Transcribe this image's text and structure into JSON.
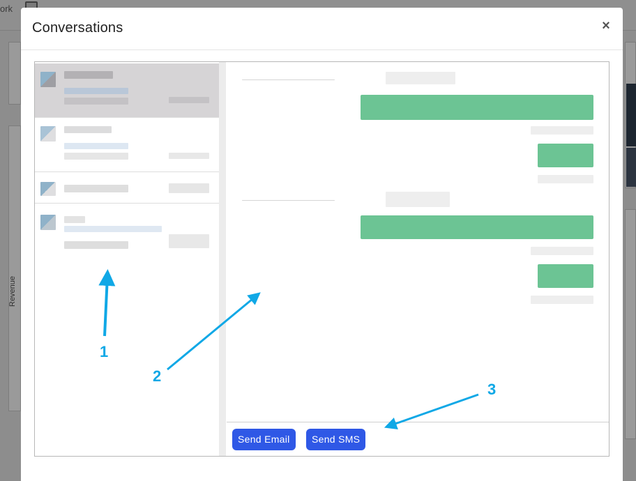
{
  "background": {
    "partial_label": "ork",
    "side_label": "Revenue"
  },
  "modal": {
    "title": "Conversations",
    "close_icon": "close-icon"
  },
  "conversations": [
    {
      "state": "selected"
    },
    {
      "state": "default"
    },
    {
      "state": "default"
    },
    {
      "state": "default"
    }
  ],
  "composer": {
    "send_email_label": "Send Email",
    "send_sms_label": "Send SMS"
  },
  "annotations": {
    "one": "1",
    "two": "2",
    "three": "3"
  },
  "colors": {
    "accent": "#2f58e6",
    "annotation": "#10a8e6",
    "outgoing_bubble": "#6cc494",
    "selected_row": "#d6d4d6"
  }
}
